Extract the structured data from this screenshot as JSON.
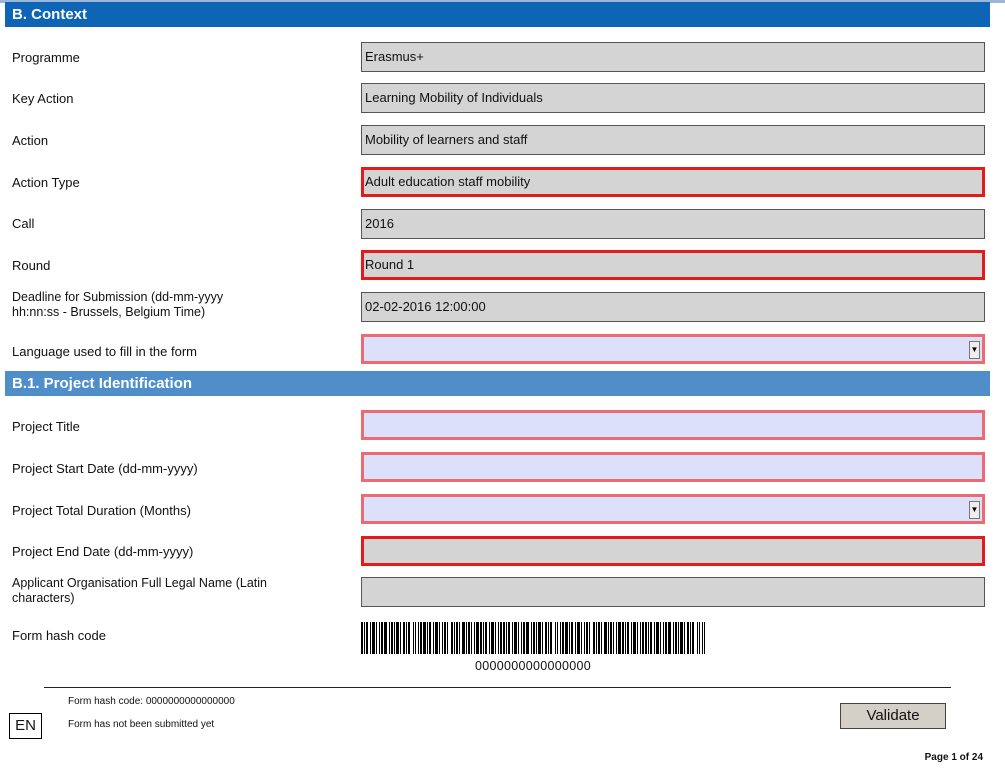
{
  "context": {
    "section_title": "B. Context",
    "programme": {
      "label": "Programme",
      "value": "Erasmus+"
    },
    "key_action": {
      "label": "Key Action",
      "value": "Learning Mobility of Individuals"
    },
    "action": {
      "label": "Action",
      "value": "Mobility of learners and staff"
    },
    "action_type": {
      "label": "Action Type",
      "value": "Adult education staff mobility"
    },
    "call": {
      "label": "Call",
      "value": "2016"
    },
    "round": {
      "label": "Round",
      "value": "Round 1"
    },
    "deadline": {
      "label_line1": "Deadline for Submission (dd-mm-yyyy",
      "label_line2": "hh:nn:ss - Brussels, Belgium Time)",
      "value": "02-02-2016 12:00:00"
    },
    "language": {
      "label": "Language used to fill in the form",
      "value": ""
    }
  },
  "project": {
    "section_title": "B.1. Project Identification",
    "title": {
      "label": "Project Title",
      "value": ""
    },
    "start_date": {
      "label": "Project Start Date (dd-mm-yyyy)",
      "value": ""
    },
    "duration": {
      "label": "Project Total Duration (Months)",
      "value": ""
    },
    "end_date": {
      "label": "Project End Date (dd-mm-yyyy)",
      "value": ""
    },
    "applicant": {
      "label_line1": "Applicant Organisation Full Legal Name (Latin",
      "label_line2": "characters)",
      "value": ""
    },
    "hash": {
      "label": "Form hash code",
      "barcode_number": "0000000000000000"
    }
  },
  "footer": {
    "hash_text": "Form hash code: 0000000000000000",
    "status_text": "Form has not been submitted yet",
    "language_code": "EN",
    "validate_label": "Validate",
    "page_text": "Page 1 of 24"
  },
  "colors": {
    "section_header": "#0e65b5",
    "subsection_header": "#4f8ec8",
    "required_border": "#e41b1b",
    "empty_required_border": "#ec6a74",
    "editable_fill": "#dde0fb",
    "readonly_fill": "#d4d4d4"
  },
  "icons": {
    "dropdown": "chevron-down-icon"
  }
}
